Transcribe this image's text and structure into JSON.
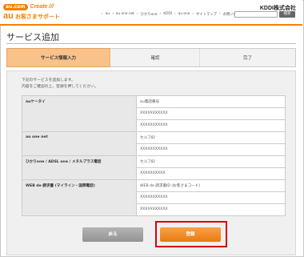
{
  "header": {
    "brand_small": "au.com",
    "brand_tagline": "Create ///",
    "brand_au": "au",
    "brand_support": "お客さまサポート",
    "company": "KDDI株式会社",
    "nav": [
      "au",
      "au one net",
      "ひかりone",
      "KDDI",
      "au one",
      "サイトマップ",
      "お問い合わせ"
    ],
    "search_label": "検索"
  },
  "page": {
    "title": "サービス追加"
  },
  "steps": [
    {
      "label": "サービス情報入力",
      "active": true
    },
    {
      "label": "確認",
      "active": false
    },
    {
      "label": "完了",
      "active": false
    }
  ],
  "intro": {
    "line1": "下記のサービスを追加します。",
    "line2": "内容をご確認の上、登録を押してください。"
  },
  "services": [
    {
      "name": "auケータイ",
      "values": [
        "au電話番号",
        "XXXXXXXXXXX",
        "XXXXXXXXXXX"
      ]
    },
    {
      "name": "au one net",
      "values": [
        "セルフID",
        "XXXXXXXXXXX"
      ]
    },
    {
      "name": "ひかりone / ADSL one / メタルプラス電話",
      "values": [
        "セルフID",
        "XXXXXXXXXX"
      ]
    },
    {
      "name": "WEB de 請求書 (マイライン・国際電話)",
      "values": [
        "WEB de 請求書ID (お客さまコード)",
        "XXXXXXXXXXX",
        "XXXXXXXXXXX"
      ]
    }
  ],
  "buttons": {
    "back": "戻る",
    "submit": "登録"
  },
  "colors": {
    "accent": "#f08300",
    "highlight": "#d9000d"
  }
}
